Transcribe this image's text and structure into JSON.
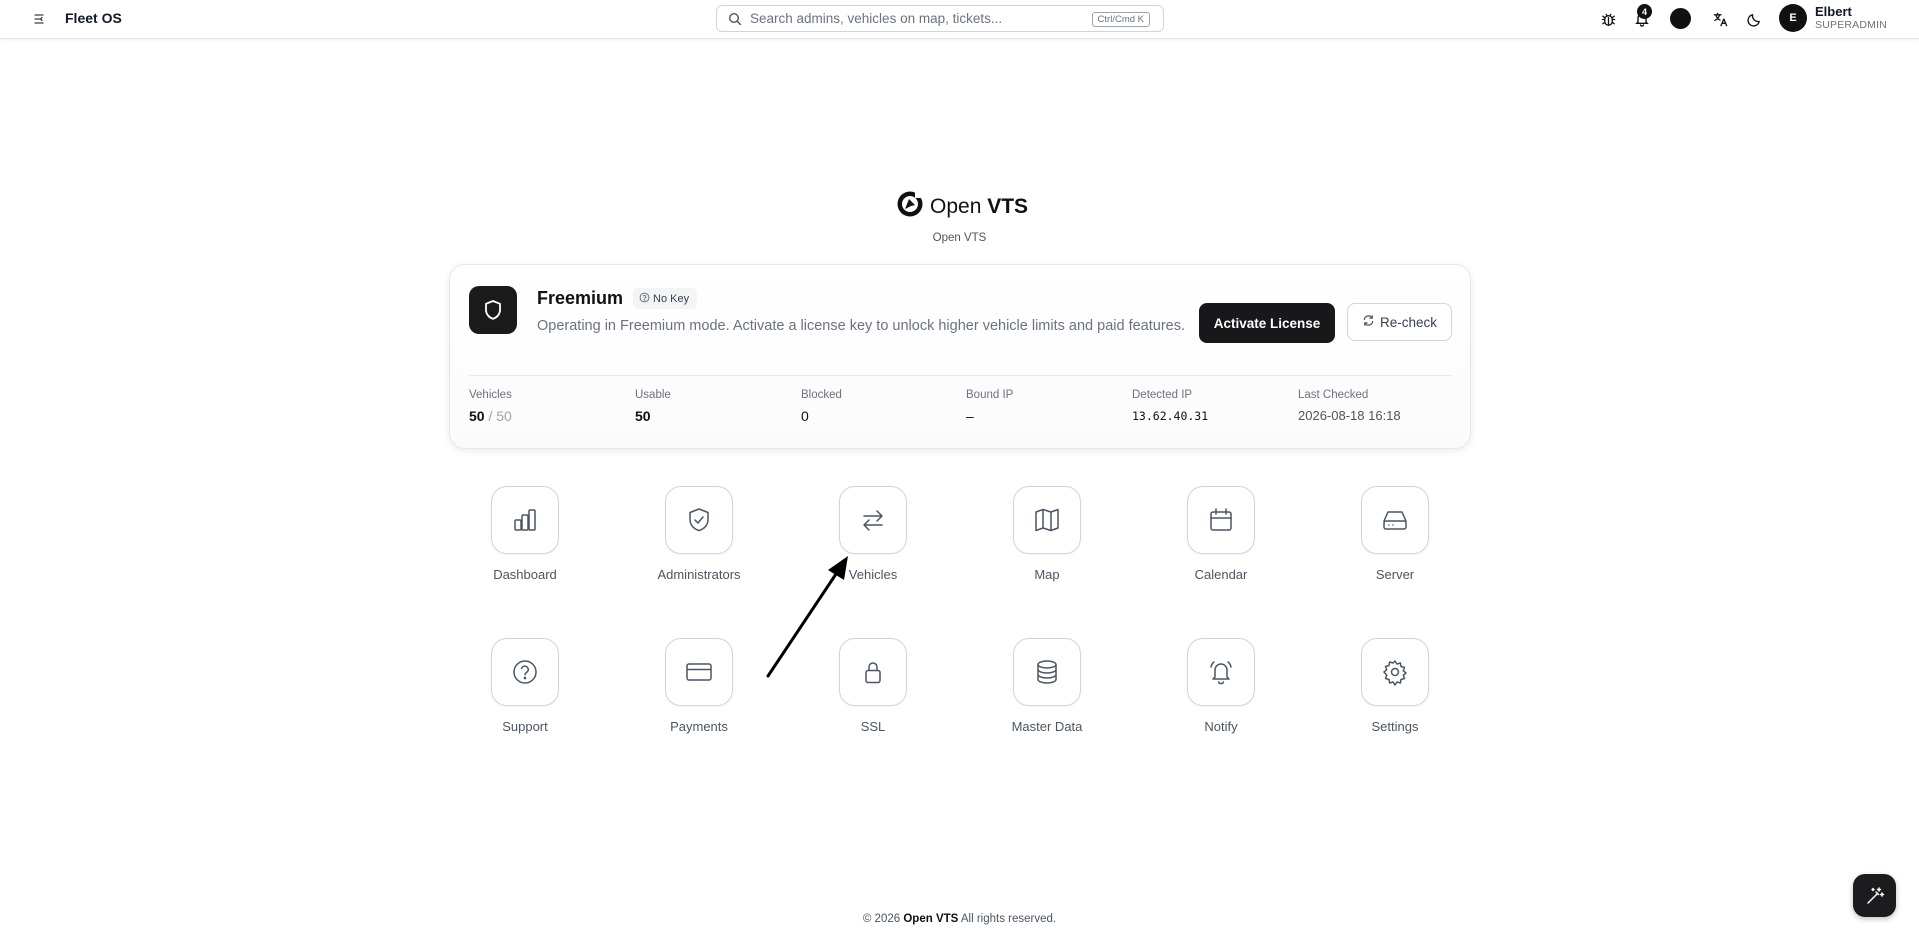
{
  "header": {
    "app_name": "Fleet OS",
    "search_placeholder": "Search admins, vehicles on map, tickets...",
    "search_shortcut": "Ctrl/Cmd K",
    "notification_count": "4",
    "user": {
      "initial": "E",
      "name": "Elbert",
      "role": "SUPERADMIN"
    },
    "icons": [
      "menu-toggle-icon",
      "search-icon",
      "bug-icon",
      "bell-icon",
      "theme-circle",
      "translate-icon",
      "moon-icon"
    ]
  },
  "brand": {
    "name_light": "Open ",
    "name_bold": "VTS",
    "subtitle": "Open VTS"
  },
  "license": {
    "plan": "Freemium",
    "badge": "No Key",
    "description": "Operating in Freemium mode. Activate a license key to unlock higher vehicle limits and paid features.",
    "activate_label": "Activate License",
    "recheck_label": "Re-check",
    "stats": {
      "vehicles": {
        "label": "Vehicles",
        "used": "50",
        "sep": "/ 50"
      },
      "usable": {
        "label": "Usable",
        "value": "50"
      },
      "blocked": {
        "label": "Blocked",
        "value": "0"
      },
      "bound_ip": {
        "label": "Bound IP",
        "value": "–"
      },
      "detected_ip": {
        "label": "Detected IP",
        "value": "13.62.40.31"
      },
      "last_checked": {
        "label": "Last Checked",
        "value": "2026-08-18 16:18"
      }
    }
  },
  "tiles": [
    {
      "label": "Dashboard",
      "icon": "bar-chart-icon"
    },
    {
      "label": "Administrators",
      "icon": "shield-check-icon"
    },
    {
      "label": "Vehicles",
      "icon": "arrows-swap-icon"
    },
    {
      "label": "Map",
      "icon": "map-icon"
    },
    {
      "label": "Calendar",
      "icon": "calendar-icon"
    },
    {
      "label": "Server",
      "icon": "hard-drive-icon"
    },
    {
      "label": "Support",
      "icon": "help-circle-icon"
    },
    {
      "label": "Payments",
      "icon": "credit-card-icon"
    },
    {
      "label": "SSL",
      "icon": "lock-icon"
    },
    {
      "label": "Master Data",
      "icon": "database-icon"
    },
    {
      "label": "Notify",
      "icon": "bell-ring-icon"
    },
    {
      "label": "Settings",
      "icon": "gear-icon"
    }
  ],
  "footer": {
    "copyright": "© 2026",
    "brand": "Open VTS",
    "rights": "All rights reserved."
  },
  "colors": {
    "accent": "#18181b",
    "muted_text": "#6b7280",
    "border": "#d1d5db"
  }
}
